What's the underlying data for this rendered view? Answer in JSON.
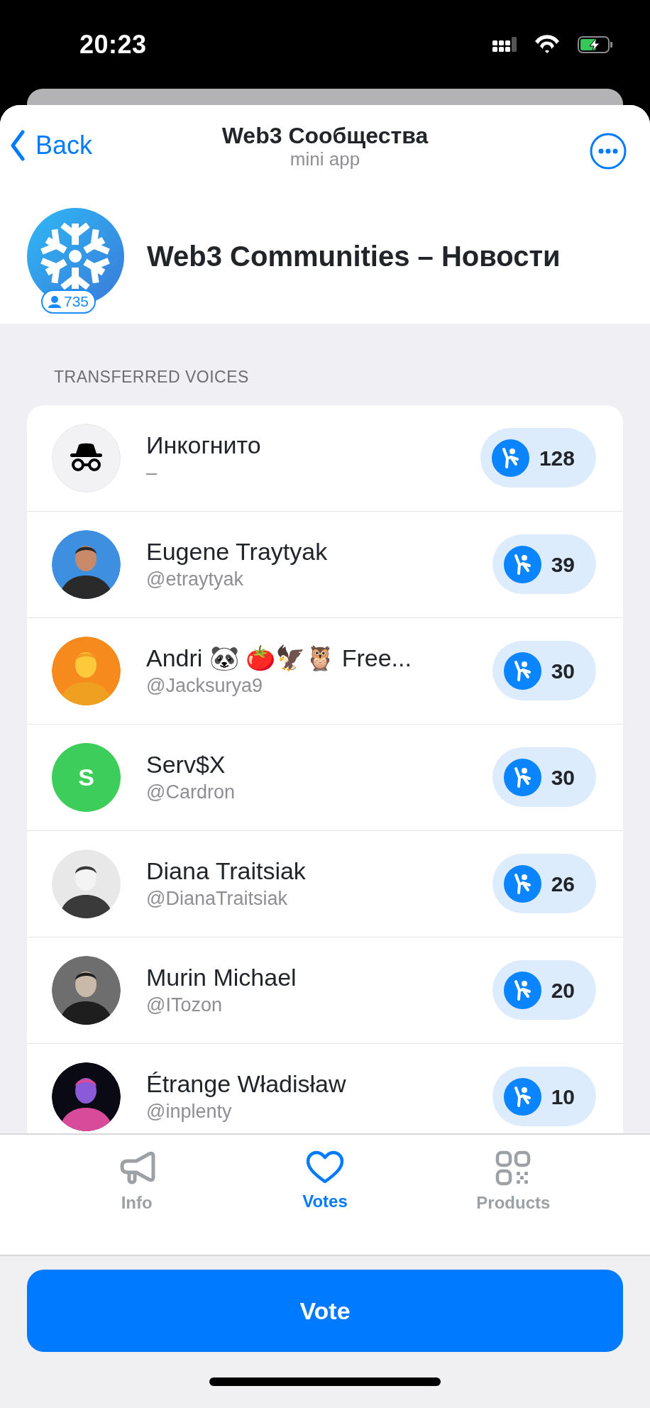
{
  "status_bar": {
    "time": "20:23"
  },
  "header": {
    "back": "Back",
    "title": "Web3 Сообщества",
    "subtitle": "mini app"
  },
  "channel": {
    "name": "Web3 Communities – Новости",
    "members": "735"
  },
  "section_title": "TRANSFERRED VOICES",
  "voters": [
    {
      "name": "Инкогнито",
      "handle": "–",
      "votes": "128",
      "avatar": {
        "kind": "incognito"
      }
    },
    {
      "name": "Eugene Traytyak",
      "handle": "@etraytyak",
      "votes": "39"
    },
    {
      "name": "Andri 🐼 🍅🦅🦉 Free...",
      "handle": "@Jacksurya9",
      "votes": "30"
    },
    {
      "name": "Serv$X",
      "handle": "@Cardron",
      "votes": "30",
      "avatar": {
        "kind": "initials",
        "text": "S",
        "color": "#3ccd5a"
      }
    },
    {
      "name": "Diana Traitsiak",
      "handle": "@DianaTraitsiak",
      "votes": "26"
    },
    {
      "name": "Murin Michael",
      "handle": "@ITozon",
      "votes": "20"
    },
    {
      "name": "Étrange Władisław",
      "handle": "@inplenty",
      "votes": "10"
    }
  ],
  "tabs": [
    {
      "label": "Info",
      "selected": false
    },
    {
      "label": "Votes",
      "selected": true
    },
    {
      "label": "Products",
      "selected": false
    }
  ],
  "vote_button": "Vote"
}
